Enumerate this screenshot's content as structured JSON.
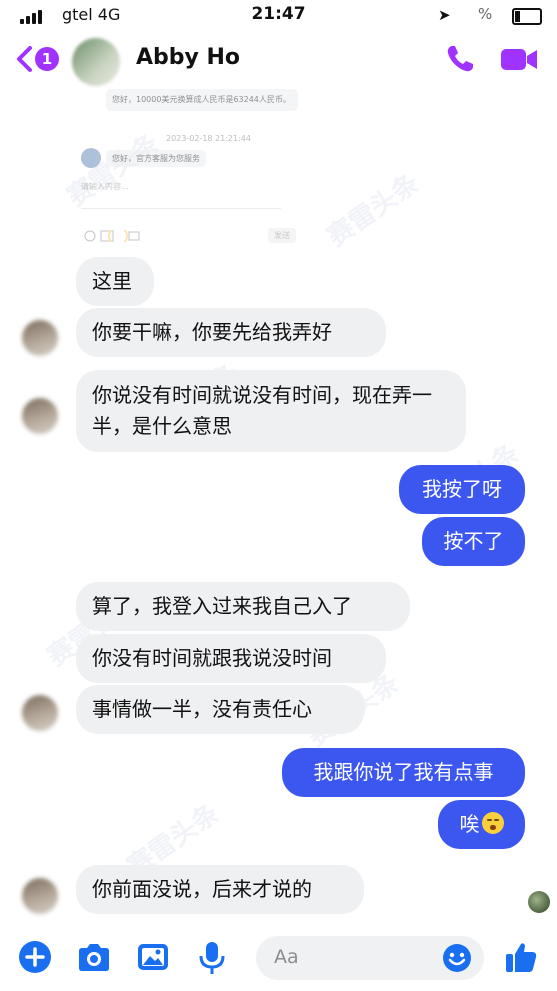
{
  "status_bar": {
    "carrier": "gtel  4G",
    "time": "21:47",
    "battery_percent": "%"
  },
  "header": {
    "back_badge": "1",
    "contact_name": "Abby Ho",
    "icons": [
      "chevron-left-icon",
      "phone-icon",
      "video-camera-icon"
    ]
  },
  "quoted_screenshot": {
    "bubble_text": "您好，10000美元换算成人民币是63244人民币。",
    "timestamp": "2023-02-18 21:21:44",
    "bubble2_text": "您好，官方客服为您服务",
    "input_placeholder": "请输入内容...",
    "send_label": "发送"
  },
  "messages": [
    {
      "side": "in",
      "text": "这里"
    },
    {
      "side": "in",
      "text": "你要干嘛，你要先给我弄好"
    },
    {
      "side": "in",
      "text": "你说没有时间就说没有时间，现在弄一半，是什么意思"
    },
    {
      "side": "out",
      "text": "我按了呀"
    },
    {
      "side": "out",
      "text": "按不了"
    },
    {
      "side": "in",
      "text": "算了，我登入过来我自己入了"
    },
    {
      "side": "in",
      "text": "你没有时间就跟我说没时间"
    },
    {
      "side": "in",
      "text": "事情做一半，没有责任心"
    },
    {
      "side": "out",
      "text": "我跟你说了我有点事"
    },
    {
      "side": "out",
      "text": "唉",
      "emoji": "anxious-face"
    },
    {
      "side": "in",
      "text": "你前面没说，后来才说的"
    }
  ],
  "composer": {
    "placeholder": "Aa",
    "icons": [
      "plus-icon",
      "camera-icon",
      "image-icon",
      "microphone-icon",
      "emoji-icon",
      "thumbs-up-icon"
    ]
  },
  "watermark": "赛雷头条",
  "colors": {
    "accent": "#a033ff",
    "outgoing_bubble": "#3c56f0",
    "incoming_bubble": "#eff0f2",
    "composer_icons": "#1a6ff0"
  }
}
